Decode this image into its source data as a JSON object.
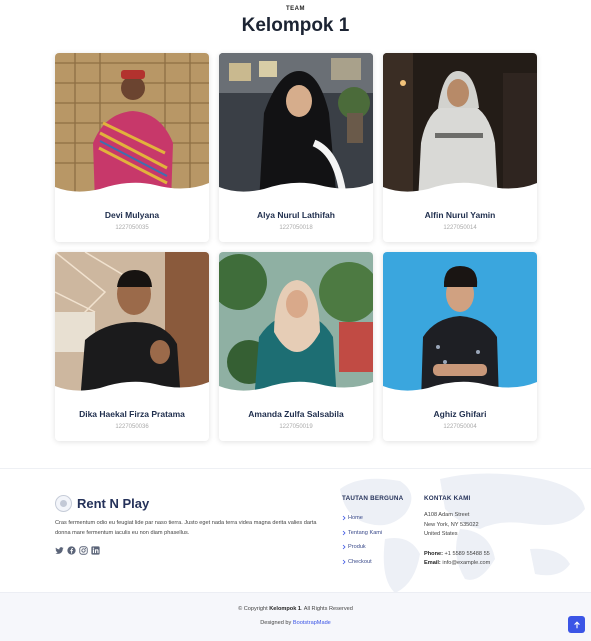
{
  "team": {
    "tag": "TEAM",
    "title": "Kelompok 1",
    "members": [
      {
        "name": "Devi Mulyana",
        "nim": "1227050035"
      },
      {
        "name": "Alya Nurul Lathifah",
        "nim": "1227050018"
      },
      {
        "name": "Alfin Nurul Yamin",
        "nim": "1227050014"
      },
      {
        "name": "Dika Haekal Firza Pratama",
        "nim": "1227050036"
      },
      {
        "name": "Amanda Zulfa Salsabila",
        "nim": "1227050019"
      },
      {
        "name": "Aghiz Ghifari",
        "nim": "1227050004"
      }
    ]
  },
  "footer": {
    "brand": "Rent N Play",
    "about": "Cras fermentum odio eu feugiat lide par naso tierra. Justo eget nada terra videa magna derita valies darta donna mare fermentum iaculis eu non diam phasellus.",
    "socials": [
      "twitter-icon",
      "facebook-icon",
      "instagram-icon",
      "linkedin-icon"
    ],
    "links_title": "TAUTAN BERGUNA",
    "links": [
      "Home",
      "Tentang Kami",
      "Produk",
      "Checkout"
    ],
    "contact_title": "KONTAK KAMI",
    "address1": "A108 Adam Street",
    "address2": "New York, NY 535022",
    "country": "United States",
    "phone_label": "Phone:",
    "phone": "+1 5589 55488 55",
    "email_label": "Email:",
    "email": "info@example.com"
  },
  "bottom": {
    "copyright_prefix": "© Copyright",
    "copyright_brand": "Kelompok 1",
    "copyright_suffix": ". All Rights Reserved",
    "designed_prefix": "Designed by",
    "designed_link": "BootstrapMade"
  },
  "colors": {
    "accent": "#3b55e6",
    "heading": "#1f2e4d"
  }
}
